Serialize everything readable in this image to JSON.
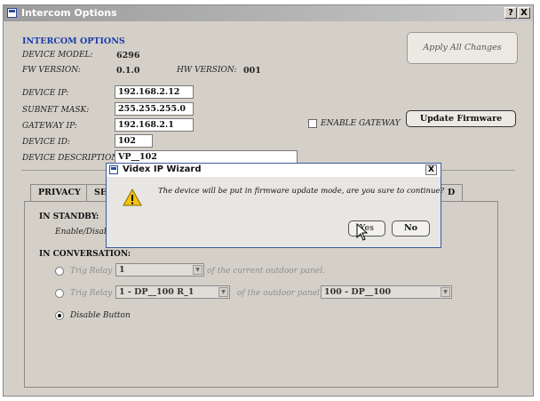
{
  "window": {
    "title": "Intercom Options",
    "help_label": "?",
    "close_label": "X"
  },
  "header": {
    "section_title": "INTERCOM OPTIONS",
    "device_model_label": "DEVICE MODEL:",
    "device_model_value": "6296",
    "fw_version_label": "FW VERSION:",
    "fw_version_value": "0.1.0",
    "hw_version_label": "HW VERSION:",
    "hw_version_value": "001"
  },
  "network": {
    "device_ip_label": "DEVICE IP:",
    "device_ip": "192.168.2.12",
    "subnet_label": "SUBNET MASK:",
    "subnet": "255.255.255.0",
    "gateway_label": "GATEWAY IP:",
    "gateway": "192.168.2.1",
    "device_id_label": "DEVICE ID:",
    "device_id": "102",
    "description_label": "DEVICE DESCRIPTION:",
    "description": "VP__102",
    "enable_gateway_label": "ENABLE GATEWAY"
  },
  "buttons": {
    "apply": "Apply All Changes",
    "update_firmware": "Update Firmware"
  },
  "tabs": [
    {
      "label": "PRIVACY"
    },
    {
      "label": "SEF"
    },
    {
      "label": "D"
    }
  ],
  "privacy": {
    "standby_title": "IN STANDBY:",
    "standby_option": "Enable/Disable",
    "conversation_title": "IN CONVERSATION:",
    "row1": {
      "radio_label": "Trig Relay",
      "combo": "1",
      "suffix": "of the current outdoor panel."
    },
    "row2": {
      "radio_label": "Trig Relay",
      "combo": "1 - DP__100  R_1",
      "suffix": "of the outdoor panel",
      "combo2": "100 - DP__100"
    },
    "row3": {
      "radio_label": "Disable Button"
    }
  },
  "dialog": {
    "title": "Videx IP Wizard",
    "close_label": "X",
    "message": "The device will be put in firmware update mode, are you sure to continue?",
    "yes_label": "Yes",
    "no_label": "No"
  },
  "colors": {
    "title_bar": "#9c9c9c",
    "header_blue": "#1a3aaa",
    "window_bg": "#d4d0c8"
  },
  "icons": {
    "dialog_icon": "warning-icon",
    "cursor": "mouse-pointer-icon"
  }
}
